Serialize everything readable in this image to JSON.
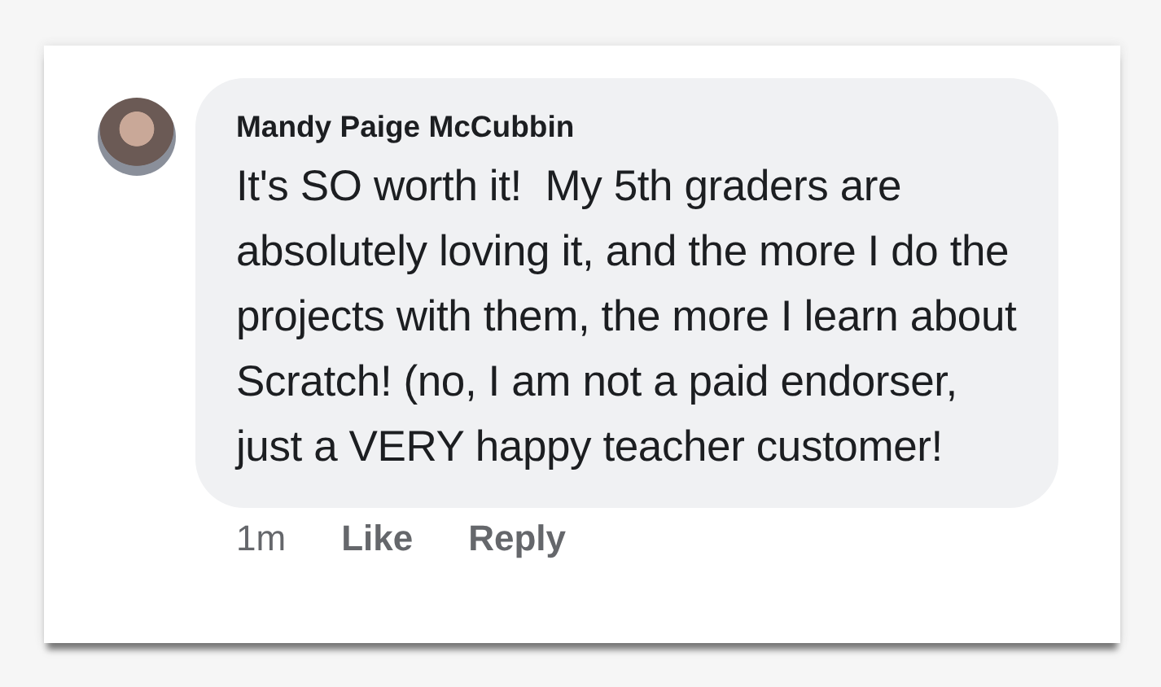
{
  "comment": {
    "author": "Mandy Paige McCubbin",
    "text": "It's SO worth it!  My 5th graders are absolutely loving it, and the more I do the projects with them, the more I learn about Scratch! (no, I am not a paid endorser, just a VERY happy teacher customer!",
    "time": "1m",
    "actions": [
      "Like",
      "Reply"
    ]
  }
}
